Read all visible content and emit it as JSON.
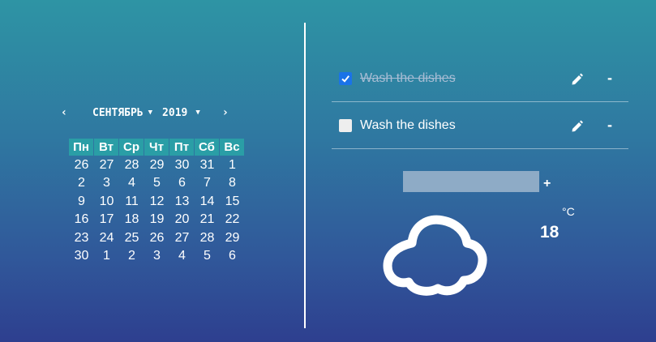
{
  "calendar": {
    "prev_label": "‹",
    "next_label": "›",
    "month": "СЕНТЯБРЬ",
    "year": "2019",
    "caret": "▼",
    "weekdays": [
      "Пн",
      "Вт",
      "Ср",
      "Чт",
      "Пт",
      "Сб",
      "Вс"
    ],
    "weeks": [
      [
        "26",
        "27",
        "28",
        "29",
        "30",
        "31",
        "1"
      ],
      [
        "2",
        "3",
        "4",
        "5",
        "6",
        "7",
        "8"
      ],
      [
        "9",
        "10",
        "11",
        "12",
        "13",
        "14",
        "15"
      ],
      [
        "16",
        "17",
        "18",
        "19",
        "20",
        "21",
        "22"
      ],
      [
        "23",
        "24",
        "25",
        "26",
        "27",
        "28",
        "29"
      ],
      [
        "30",
        "1",
        "2",
        "3",
        "4",
        "5",
        "6"
      ]
    ]
  },
  "todos": [
    {
      "text": "Wash the dishes",
      "done": true,
      "edit_icon": "pencil-icon",
      "delete_label": "-"
    },
    {
      "text": "Wash the dishes",
      "done": false,
      "edit_icon": "pencil-icon",
      "delete_label": "-"
    }
  ],
  "add": {
    "value": "",
    "button_label": "+"
  },
  "weather": {
    "icon": "cloud-icon",
    "unit": "°C",
    "temperature": "18"
  },
  "colors": {
    "gradient_top": "#2e94a4",
    "gradient_bottom": "#2e3f8f",
    "weekday_bg": "#2a9ea6",
    "checkbox_checked": "#1a73e8",
    "input_bg": "#8eabc6"
  }
}
